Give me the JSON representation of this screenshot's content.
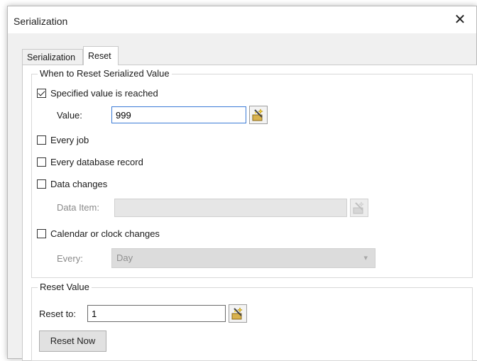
{
  "window": {
    "title": "Serialization",
    "close_glyph": "✕"
  },
  "tabs": [
    {
      "label": "Serialization",
      "active": false
    },
    {
      "label": "Reset",
      "active": true
    }
  ],
  "when_group": {
    "label": "When to Reset Serialized Value",
    "specified": {
      "label": "Specified value is reached",
      "checked": true
    },
    "value_label": "Value:",
    "value": "999",
    "every_job": {
      "label": "Every job",
      "checked": false
    },
    "every_db": {
      "label": "Every database record",
      "checked": false
    },
    "data_changes": {
      "label": "Data changes",
      "checked": false
    },
    "data_item_label": "Data Item:",
    "data_item_value": "",
    "calendar": {
      "label": "Calendar or clock changes",
      "checked": false
    },
    "every_label": "Every:",
    "every_value": "Day"
  },
  "reset_group": {
    "label": "Reset Value",
    "reset_to_label": "Reset to:",
    "reset_to_value": "1",
    "reset_now_label": "Reset Now"
  },
  "icons": [
    "wizard-icon",
    "checkbox-check-icon",
    "chevron-down-icon",
    "close-icon"
  ]
}
